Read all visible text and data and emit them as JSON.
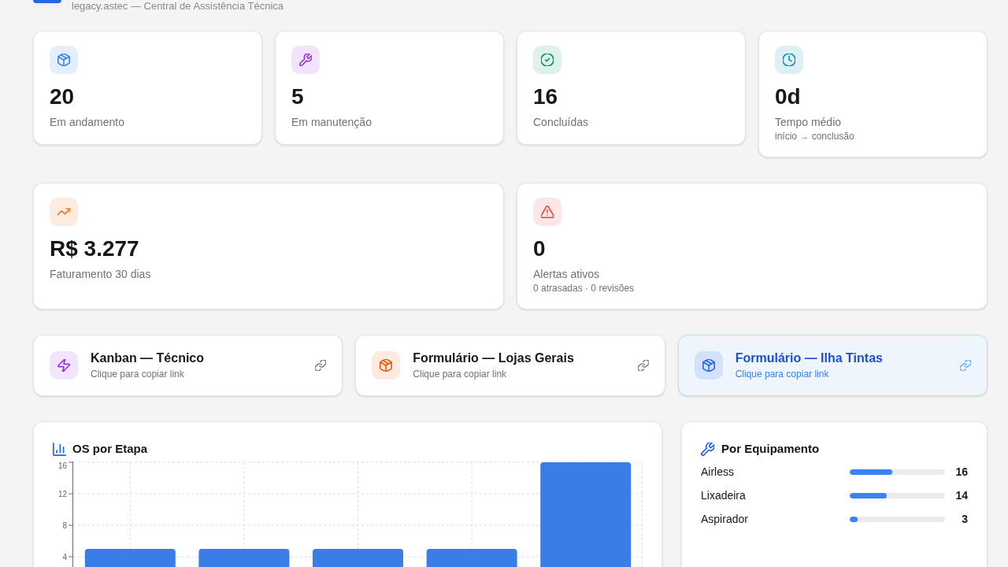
{
  "header": {
    "subtitle": "legacy.astec — Central de Assistência Técnica"
  },
  "stats": [
    {
      "value": "20",
      "label": "Em andamento",
      "color": "#3b82f6"
    },
    {
      "value": "5",
      "label": "Em manutenção",
      "color": "#9333ea"
    },
    {
      "value": "16",
      "label": "Concluídas",
      "color": "#059669"
    },
    {
      "value": "0d",
      "label": "Tempo médio",
      "note": "início → conclusão",
      "color": "#0891b2"
    }
  ],
  "highlights": [
    {
      "value": "R$ 3.277",
      "label": "Faturamento 30 dias",
      "color": "#f97316"
    },
    {
      "value": "0",
      "label": "Alertas ativos",
      "note": "0 atrasadas · 0 revisões",
      "color": "#ef4444"
    }
  ],
  "links": [
    {
      "title": "Kanban — Técnico",
      "hint": "Clique para copiar link",
      "color": "#9333ea",
      "selected": false
    },
    {
      "title": "Formulário — Lojas Gerais",
      "hint": "Clique para copiar link",
      "color": "#ea580c",
      "selected": false
    },
    {
      "title": "Formulário — Ilha Tintas",
      "hint": "Clique para copiar link",
      "color": "#2563eb",
      "selected": true
    }
  ],
  "stage_chart": {
    "title": "OS por Etapa",
    "chart_data": {
      "type": "bar",
      "values": [
        5,
        5,
        5,
        5,
        16
      ],
      "ylim": [
        0,
        16
      ],
      "yticks": [
        4,
        8,
        12,
        16
      ],
      "grid": true
    }
  },
  "equipment": {
    "title": "Por Equipamento",
    "items": [
      {
        "name": "Airless",
        "level": 0.45,
        "count": "16"
      },
      {
        "name": "Lixadeira",
        "level": 0.39,
        "count": "14"
      },
      {
        "name": "Aspirador",
        "level": 0.08,
        "count": "3"
      }
    ]
  }
}
